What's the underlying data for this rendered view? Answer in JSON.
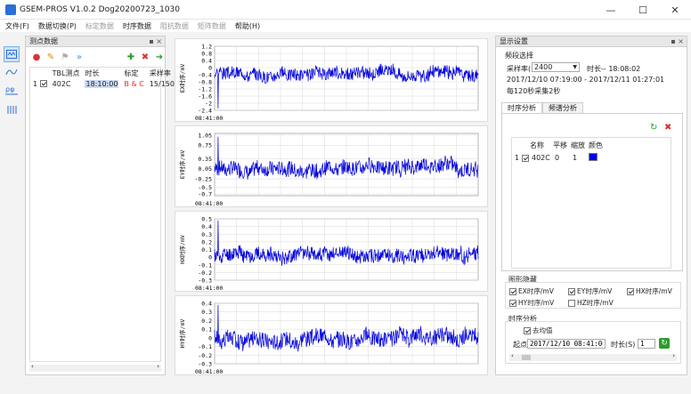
{
  "window": {
    "title": "GSEM-PROS V1.0.2   Dog20200723_1030"
  },
  "menu": [
    {
      "label": "文件(F)",
      "enabled": true
    },
    {
      "label": "数据切换(P)",
      "enabled": true
    },
    {
      "label": "标定数据",
      "enabled": false
    },
    {
      "label": "时序数据",
      "enabled": true
    },
    {
      "label": "阻抗数据",
      "enabled": false
    },
    {
      "label": "矩阵数据",
      "enabled": false
    },
    {
      "label": "帮助(H)",
      "enabled": true
    }
  ],
  "point_panel": {
    "title": "测点数据",
    "columns": [
      "TBL测点",
      "时长",
      "标定",
      "采样率"
    ],
    "rows": [
      {
        "index": "1",
        "name": "402C",
        "duration": "18:10:00",
        "calib": "B & C",
        "rate": "15/150/2400"
      }
    ]
  },
  "display_panel": {
    "title": "显示设置",
    "freq_section": "频段选择",
    "rate_label": "采样率(",
    "rate_value": "2400",
    "duration_text": "时长-- 18:08:02",
    "range_text": "2017/12/10 07:19:00 - 2017/12/11 01:27:01",
    "sample_text": "每120秒采集2秒",
    "tabs": [
      "时序分析",
      "频谱分析"
    ],
    "table_cols": [
      "名称",
      "平移",
      "缩放",
      "颜色"
    ],
    "table_row": {
      "index": "1",
      "name": "402C",
      "shift": "0",
      "scale": "1",
      "color": "#0000ee"
    },
    "hide_section": "图形隐藏",
    "hide_items": [
      {
        "label": "EX时序/mV",
        "checked": true
      },
      {
        "label": "EY时序/mV",
        "checked": true
      },
      {
        "label": "HX时序/mV",
        "checked": true
      },
      {
        "label": "HY时序/mV",
        "checked": true
      },
      {
        "label": "HZ时序/mV",
        "checked": false
      }
    ],
    "ts_section": "时序分析",
    "remove_mean": "去均值",
    "start_label": "起点",
    "start_value": "2017/12/10 08:41:00",
    "dur_label": "时长(S)",
    "dur_value": "1"
  },
  "colors": {
    "trace": "#0000dd",
    "accent": "#2a6fd6"
  },
  "chart_data": [
    {
      "type": "line",
      "ylabel": "EX时序/mV",
      "x_label": "08:41:00",
      "yticks": [
        "1.2",
        "0.8",
        "0.4",
        "0",
        "-0.4",
        "-0.8",
        "-1.2",
        "-1.6",
        "-2",
        "-2.4"
      ],
      "ylim": [
        -2.4,
        1.2
      ],
      "amp": 0.45,
      "offset": -0.35,
      "seed": 3,
      "spike": -2.3
    },
    {
      "type": "line",
      "ylabel": "EY时序/mV",
      "x_label": "08:41:00",
      "yticks": [
        "1.05",
        "0.75",
        "0.35",
        "0.05",
        "-0.25",
        "-0.5",
        "-0.7"
      ],
      "ylim": [
        -0.75,
        1.1
      ],
      "amp": 0.28,
      "offset": 0.1,
      "seed": 7,
      "spike": 1.0
    },
    {
      "type": "line",
      "ylabel": "HX时序/mV",
      "x_label": "08:41:00",
      "yticks": [
        "0.5",
        "0.4",
        "0.3",
        "0.2",
        "0.1",
        "0",
        "-0.1",
        "-0.2",
        "-0.3"
      ],
      "ylim": [
        -0.3,
        0.5
      ],
      "amp": 0.12,
      "offset": 0.02,
      "seed": 11,
      "spike": 0.48
    },
    {
      "type": "line",
      "ylabel": "HY时序/mV",
      "x_label": "08:41:00",
      "yticks": [
        "0.4",
        "0.3",
        "0.2",
        "0.1",
        "0",
        "-0.1",
        "-0.2",
        "-0.3"
      ],
      "ylim": [
        -0.3,
        0.4
      ],
      "amp": 0.12,
      "offset": 0.0,
      "seed": 17,
      "spike": 0.38
    }
  ]
}
